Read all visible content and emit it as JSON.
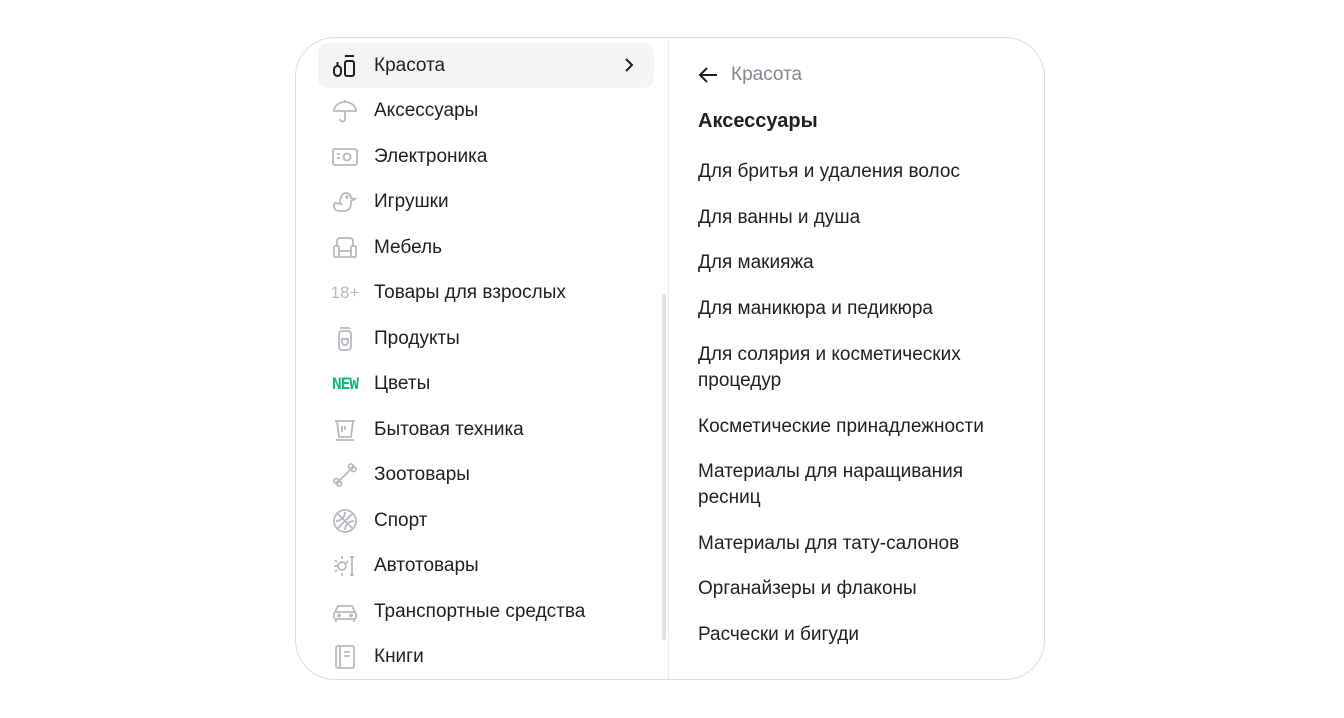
{
  "categories": [
    {
      "label": "Красота",
      "icon": "beauty-bottles-icon"
    },
    {
      "label": "Аксессуары",
      "icon": "umbrella-icon"
    },
    {
      "label": "Электроника",
      "icon": "electronics-icon"
    },
    {
      "label": "Игрушки",
      "icon": "duck-toy-icon"
    },
    {
      "label": "Мебель",
      "icon": "armchair-icon"
    },
    {
      "label": "Товары для взрослых",
      "icon": "adult-18-icon",
      "icon_text": "18+"
    },
    {
      "label": "Продукты",
      "icon": "jar-icon"
    },
    {
      "label": "Цветы",
      "icon": "new-badge-icon",
      "icon_text": "NEW"
    },
    {
      "label": "Бытовая техника",
      "icon": "kettle-icon"
    },
    {
      "label": "Зоотовары",
      "icon": "bone-icon"
    },
    {
      "label": "Спорт",
      "icon": "basketball-icon"
    },
    {
      "label": "Автотовары",
      "icon": "car-parts-icon"
    },
    {
      "label": "Транспортные средства",
      "icon": "car-icon"
    },
    {
      "label": "Книги",
      "icon": "book-icon"
    }
  ],
  "active_category": "Красота",
  "detail": {
    "back_label": "Красота",
    "title": "Аксессуары",
    "items": [
      "Для бритья и удаления волос",
      "Для ванны и душа",
      "Для макияжа",
      "Для маникюра и педикюра",
      "Для солярия и косметических процедур",
      "Косметические принадлежности",
      "Материалы для наращивания ресниц",
      "Материалы для тату-салонов",
      "Органайзеры и флаконы",
      "Расчески и бигуди"
    ]
  },
  "colors": {
    "accent_new": "#10b981",
    "active_bg": "#f4f4f6",
    "icon_gray": "#b8b8c0"
  }
}
